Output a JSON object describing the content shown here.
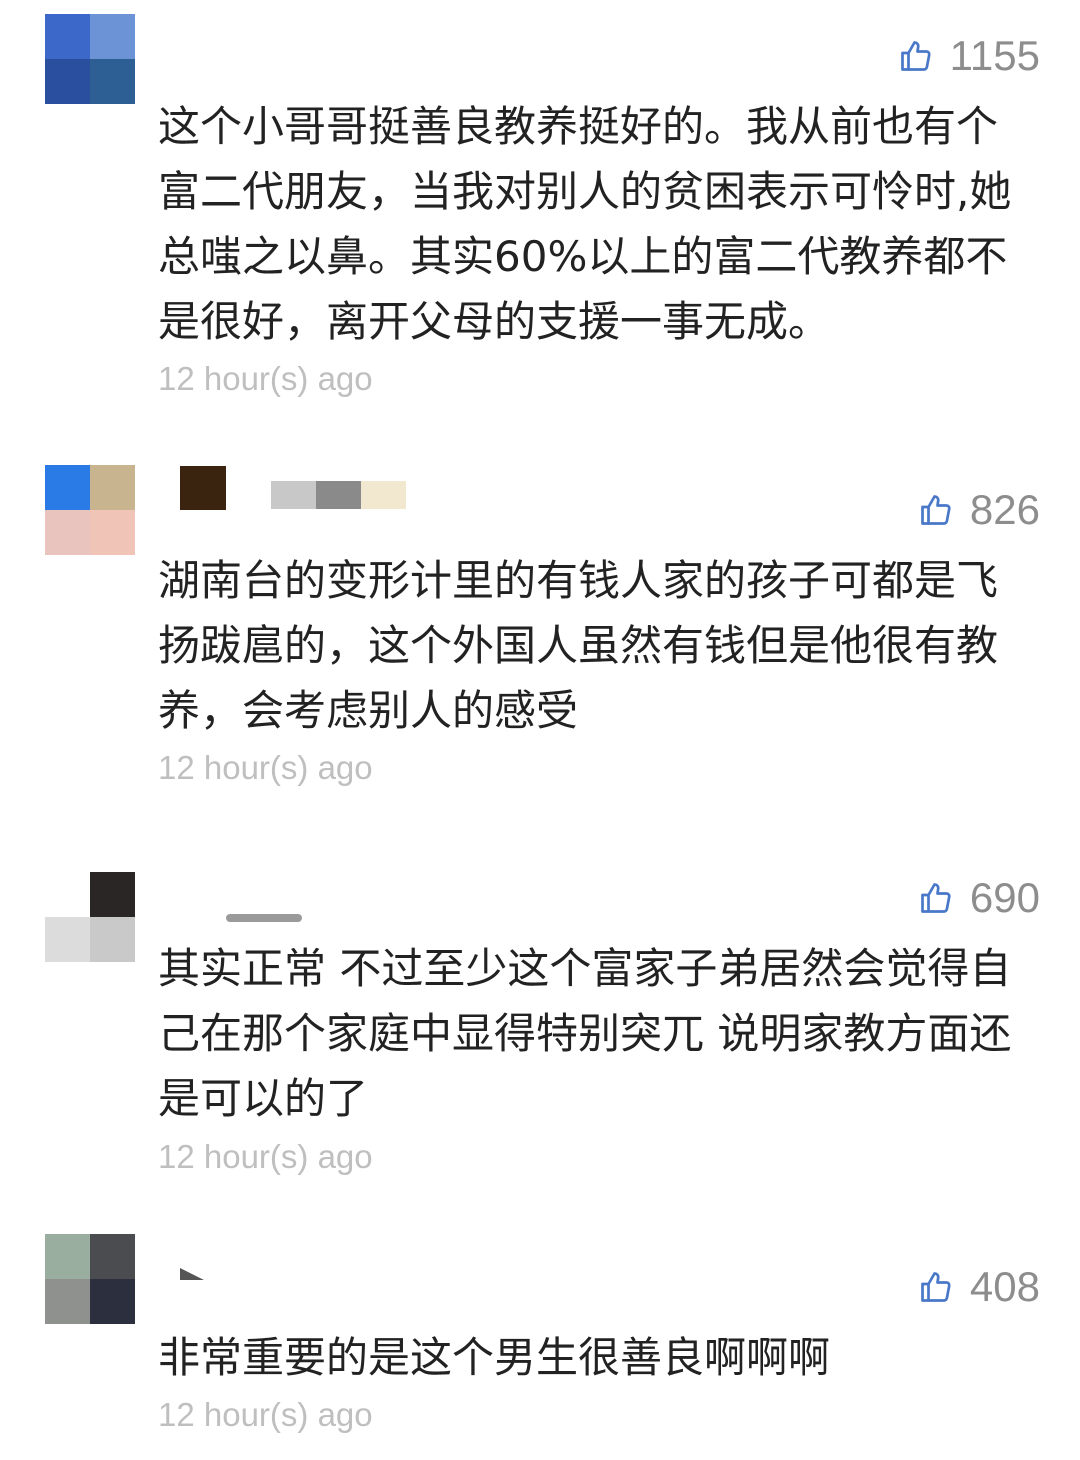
{
  "comments": [
    {
      "likes": "1155",
      "text": "这个小哥哥挺善良教养挺好的。我从前也有个富二代朋友，当我对别人的贫困表示可怜时,她总嗤之以鼻。其实60%以上的富二代教养都不是很好，离开父母的支援一事无成。",
      "time": "12 hour(s) ago",
      "avatar_colors": [
        "#3b68c9",
        "#6b93d6",
        "#2b4f9f",
        "#2d5f95"
      ]
    },
    {
      "likes": "826",
      "text": "湖南台的变形计里的有钱人家的孩子可都是飞扬跋扈的，这个外国人虽然有钱但是他很有教养，会考虑别人的感受",
      "time": "12 hour(s) ago",
      "avatar_colors": [
        "#2b7be6",
        "#c8b48e",
        "#e9c3bd",
        "#f0c4b6"
      ]
    },
    {
      "likes": "690",
      "text": "其实正常 不过至少这个富家子弟居然会觉得自己在那个家庭中显得特别突兀 说明家教方面还是可以的了",
      "time": "12 hour(s) ago",
      "avatar_colors": [
        "#ffffff",
        "#2a2626",
        "#dcdcdc",
        "#c9c9c9"
      ]
    },
    {
      "likes": "408",
      "text": "非常重要的是这个男生很善良啊啊啊",
      "time": "12 hour(s) ago",
      "avatar_colors": [
        "#9aaea0",
        "#4a4c4f",
        "#8f918f",
        "#2c2f3e"
      ]
    }
  ],
  "icons": {
    "like": "thumbs-up-icon"
  }
}
